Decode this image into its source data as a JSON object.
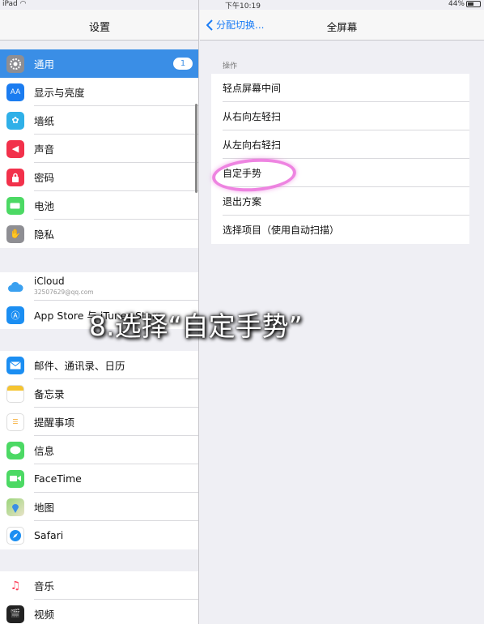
{
  "status": {
    "device": "iPad",
    "time": "下午10:19",
    "battery": "44%",
    "battery_level": 0.44
  },
  "sidebar": {
    "title": "设置",
    "items": [
      {
        "label": "通用",
        "icon": "gear-icon",
        "color": "#8e8e93",
        "badge": "1",
        "active": true
      },
      {
        "label": "显示与亮度",
        "icon": "text-size-icon",
        "color": "#1b7cf0"
      },
      {
        "label": "墙纸",
        "icon": "wallpaper-icon",
        "color": "#2fb0e8"
      },
      {
        "label": "声音",
        "icon": "speaker-icon",
        "color": "#f2314b"
      },
      {
        "label": "密码",
        "icon": "lock-icon",
        "color": "#f2314b"
      },
      {
        "label": "电池",
        "icon": "battery-icon",
        "color": "#4cd964"
      },
      {
        "label": "隐私",
        "icon": "hand-icon",
        "color": "#8e8e93"
      }
    ],
    "accounts": [
      {
        "label": "iCloud",
        "sub": "32507629@qq.com",
        "icon": "cloud-icon"
      },
      {
        "label": "App Store 与 iTunes Store",
        "icon": "appstore-icon",
        "color": "#1b8ef2"
      }
    ],
    "apps": [
      {
        "label": "邮件、通讯录、日历",
        "icon": "mail-icon",
        "color": "#1b8ef2"
      },
      {
        "label": "备忘录",
        "icon": "notes-icon",
        "color": "#f5c431"
      },
      {
        "label": "提醒事项",
        "icon": "reminders-icon",
        "color": "#ffffff"
      },
      {
        "label": "信息",
        "icon": "message-icon",
        "color": "#4cd964"
      },
      {
        "label": "FaceTime",
        "icon": "facetime-icon",
        "color": "#4cd964"
      },
      {
        "label": "地图",
        "icon": "maps-icon",
        "color": "#7fc45a"
      },
      {
        "label": "Safari",
        "icon": "safari-icon",
        "color": "#1b8ef2"
      }
    ],
    "media": [
      {
        "label": "音乐",
        "icon": "music-icon",
        "color": "#ffffff"
      },
      {
        "label": "视频",
        "icon": "video-icon",
        "color": "#222222"
      }
    ]
  },
  "detail": {
    "back_label": "分配切换...",
    "title": "全屏幕",
    "section": "操作",
    "options": [
      "轻点屏幕中间",
      "从右向左轻扫",
      "从左向右轻扫",
      "自定手势",
      "退出方案",
      "选择项目（使用自动扫描）"
    ]
  },
  "annotation": "8.选择“自定手势”"
}
